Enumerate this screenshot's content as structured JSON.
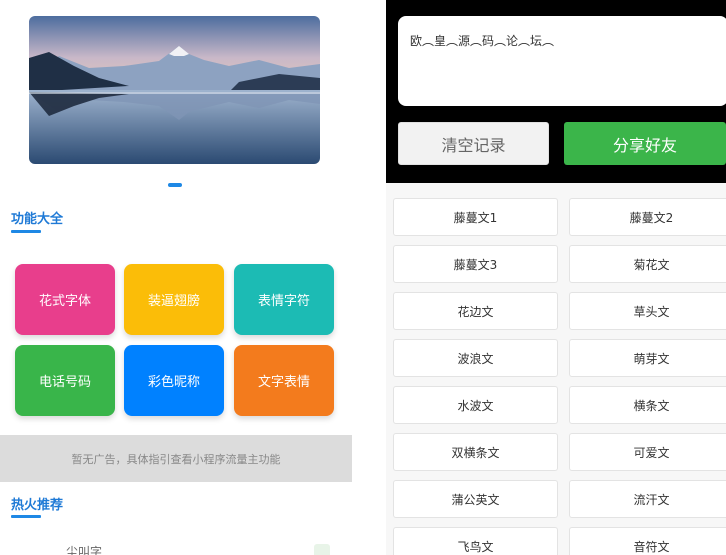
{
  "features": {
    "title": "功能大全",
    "tiles": [
      {
        "label": "花式字体",
        "color": "#e83e8c"
      },
      {
        "label": "装逼翅膀",
        "color": "#fbbd08"
      },
      {
        "label": "表情字符",
        "color": "#1cbbb4"
      },
      {
        "label": "电话号码",
        "color": "#39b54a"
      },
      {
        "label": "彩色昵称",
        "color": "#0081ff"
      },
      {
        "label": "文字表情",
        "color": "#f37b1d"
      }
    ]
  },
  "ad": {
    "text": "暂无广告，具体指引查看小程序流量主功能"
  },
  "hot": {
    "title": "热火推荐",
    "first_item": "尘叫字"
  },
  "editor": {
    "text": "欧︵皇︵源︵码︵论︵坛︵",
    "clear_label": "清空记录",
    "share_label": "分享好友"
  },
  "styles": [
    "藤蔓文1",
    "藤蔓文2",
    "藤蔓文3",
    "菊花文",
    "花边文",
    "草头文",
    "波浪文",
    "萌芽文",
    "水波文",
    "横条文",
    "双横条文",
    "可爱文",
    "蒲公英文",
    "流汗文",
    "飞鸟文",
    "音符文"
  ],
  "colors": {
    "accent": "#1e88e5",
    "share": "#3bb54a"
  }
}
